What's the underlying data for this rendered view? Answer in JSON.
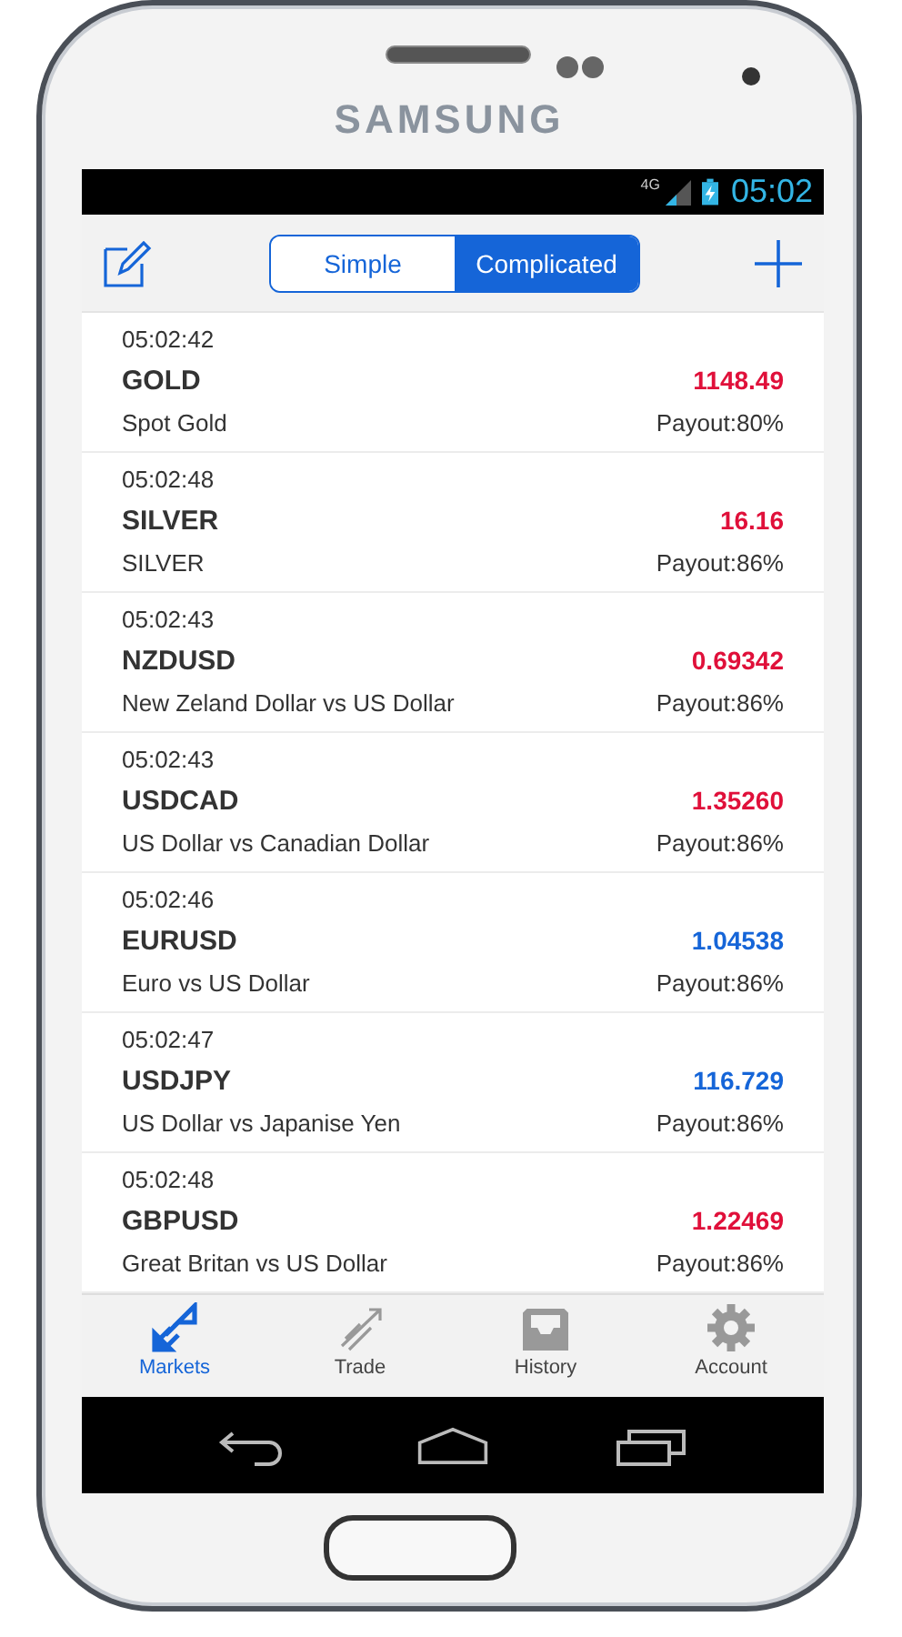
{
  "device": {
    "brand": "SAMSUNG"
  },
  "status_bar": {
    "network": "4G",
    "time": "05:02"
  },
  "toolbar": {
    "segments": [
      {
        "label": "Simple",
        "selected": false
      },
      {
        "label": "Complicated",
        "selected": true
      }
    ]
  },
  "quotes": [
    {
      "time": "05:02:42",
      "symbol": "GOLD",
      "price": "1148.49",
      "color": "#e0103a",
      "description": "Spot Gold",
      "payout": "Payout:80%"
    },
    {
      "time": "05:02:48",
      "symbol": "SILVER",
      "price": "16.16",
      "color": "#e0103a",
      "description": "SILVER",
      "payout": "Payout:86%"
    },
    {
      "time": "05:02:43",
      "symbol": "NZDUSD",
      "price": "0.69342",
      "color": "#e0103a",
      "description": "New Zeland Dollar vs US Dollar",
      "payout": "Payout:86%"
    },
    {
      "time": "05:02:43",
      "symbol": "USDCAD",
      "price": "1.35260",
      "color": "#e0103a",
      "description": "US Dollar vs Canadian Dollar",
      "payout": "Payout:86%"
    },
    {
      "time": "05:02:46",
      "symbol": "EURUSD",
      "price": "1.04538",
      "color": "#1565d8",
      "description": "Euro vs US Dollar",
      "payout": "Payout:86%"
    },
    {
      "time": "05:02:47",
      "symbol": "USDJPY",
      "price": "116.729",
      "color": "#1565d8",
      "description": "US Dollar vs Japanise Yen",
      "payout": "Payout:86%"
    },
    {
      "time": "05:02:48",
      "symbol": "GBPUSD",
      "price": "1.22469",
      "color": "#e0103a",
      "description": "Great Britan vs US Dollar",
      "payout": "Payout:86%"
    }
  ],
  "tab_bar": [
    {
      "kind": "markets",
      "label": "Markets",
      "selected": true
    },
    {
      "kind": "trade",
      "label": "Trade",
      "selected": false
    },
    {
      "kind": "history",
      "label": "History",
      "selected": false
    },
    {
      "kind": "account",
      "label": "Account",
      "selected": false
    }
  ]
}
